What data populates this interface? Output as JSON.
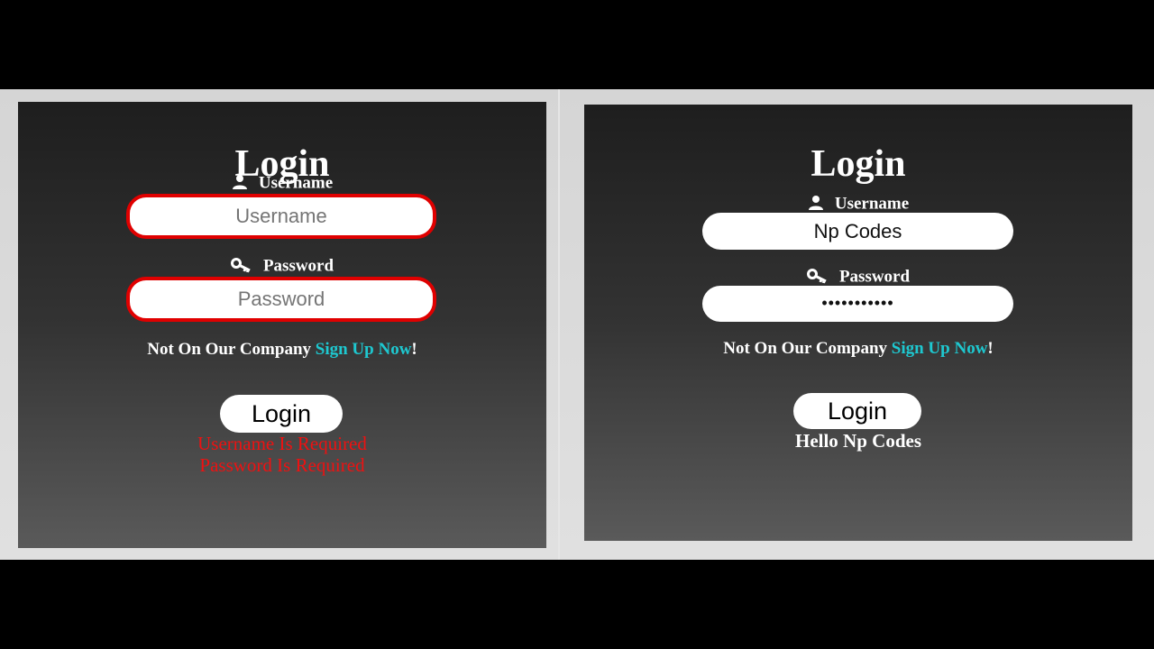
{
  "left_form": {
    "title": "Login",
    "username_label": "Username",
    "username_placeholder": "Username",
    "username_value": "",
    "password_label": "Password",
    "password_placeholder": "Password",
    "password_value": "",
    "signup_prefix": "Not On Our Company ",
    "signup_link": "Sign Up Now",
    "signup_suffix": "!",
    "login_button": "Login",
    "errors": [
      "Username Is Required",
      "Password Is Required"
    ],
    "error_color": "#e00000"
  },
  "right_form": {
    "title": "Login",
    "username_label": "Username",
    "username_value": "Np Codes",
    "password_label": "Password",
    "password_value": "•••••••••••",
    "signup_prefix": "Not On Our Company ",
    "signup_link": "Sign Up Now",
    "signup_suffix": "!",
    "login_button": "Login",
    "greeting": "Hello Np Codes"
  },
  "icons": {
    "user": "user-icon",
    "key": "key-icon"
  },
  "colors": {
    "link": "#1ec8d0",
    "error": "#ee1111"
  }
}
